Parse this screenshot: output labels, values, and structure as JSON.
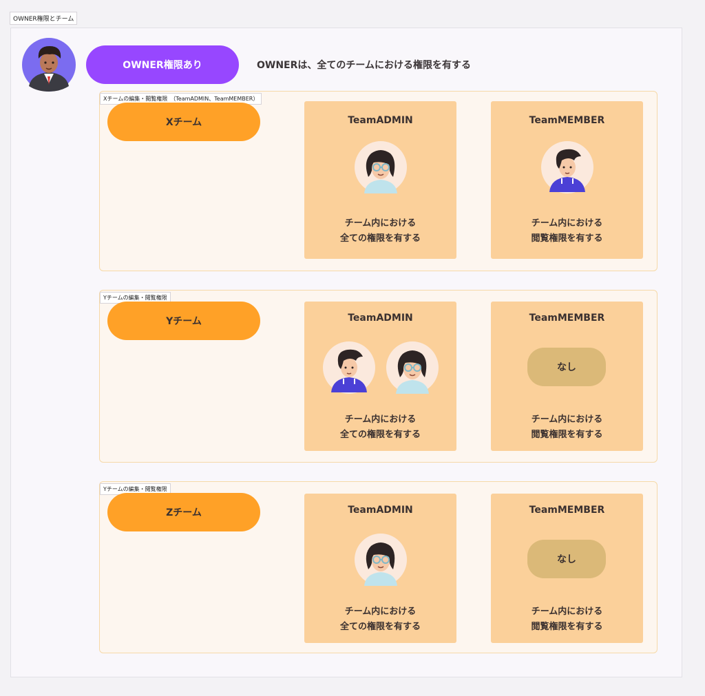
{
  "frame": {
    "label": "OWNER権限とチーム"
  },
  "owner": {
    "badge": "OWNER権限あり",
    "description": "OWNERは、全てのチームにおける権限を有する"
  },
  "sections": [
    {
      "label": "Xチームの編集・閲覧権限　（TeamADMIN、TeamMEMBER）",
      "team": "Xチーム",
      "admin": {
        "title": "TeamADMIN",
        "desc1": "チーム内における",
        "desc2": "全ての権限を有する"
      },
      "member": {
        "title": "TeamMEMBER",
        "desc1": "チーム内における",
        "desc2": "閲覧権限を有する"
      }
    },
    {
      "label": "Yチームの編集・閲覧権限",
      "team": "Yチーム",
      "admin": {
        "title": "TeamADMIN",
        "desc1": "チーム内における",
        "desc2": "全ての権限を有する"
      },
      "member": {
        "title": "TeamMEMBER",
        "none": "なし",
        "desc1": "チーム内における",
        "desc2": "閲覧権限を有する"
      }
    },
    {
      "label": "Yチームの編集・閲覧権限",
      "team": "Zチーム",
      "admin": {
        "title": "TeamADMIN",
        "desc1": "チーム内における",
        "desc2": "全ての権限を有する"
      },
      "member": {
        "title": "TeamMEMBER",
        "none": "なし",
        "desc1": "チーム内における",
        "desc2": "閲覧権限を有する"
      }
    }
  ],
  "colors": {
    "owner_accent": "#9747ff",
    "team_accent": "#ffa127",
    "card": "#fbd09a",
    "none_badge": "#dbb978",
    "section_bg": "#fdf6ef"
  },
  "icons": {
    "owner_avatar": "man-in-suit-avatar",
    "female_avatar": "woman-with-glasses-avatar",
    "male_avatar": "man-in-hoodie-avatar"
  }
}
